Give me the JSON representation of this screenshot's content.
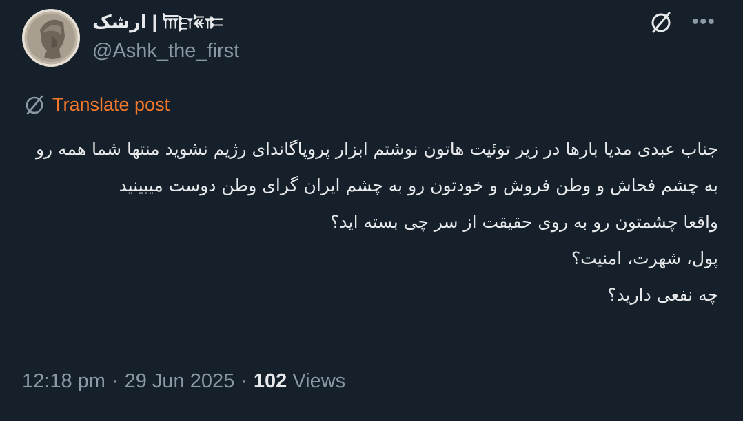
{
  "author": {
    "display_name": "ارشک | 𐎠𐎼𐏁𐎣",
    "handle": "@Ashk_the_first"
  },
  "icons": {
    "grok": "slashed-circle-icon",
    "more": "more-icon",
    "translate": "translate-icon"
  },
  "translate": {
    "label": "Translate post"
  },
  "post": {
    "lines": [
      "جناب عبدی مدیا بارها در زیر توئیت هاتون نوشتم ابزار پروپاگاندای رژیم نشوید منتها شما همه رو به چشم فحاش و وطن فروش و خودتون رو به چشم ایران گرای وطن دوست میبینید",
      "واقعا چشمتون رو به روی حقیقت از سر چی بسته اید؟",
      "پول، شهرت، امنیت؟",
      "چه نفعی دارید؟"
    ]
  },
  "meta": {
    "time": "12:18 pm",
    "separator": "·",
    "date": "29 Jun 2025",
    "views_count": "102",
    "views_label": "Views"
  },
  "colors": {
    "background": "#15202b",
    "text": "#e7e9ea",
    "secondary": "#8b98a5",
    "translate_accent": "#f5782a"
  }
}
